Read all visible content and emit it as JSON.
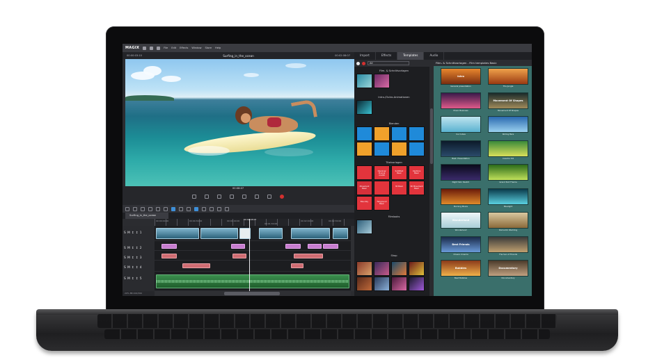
{
  "app": {
    "logo": "MAGIX",
    "menu": [
      "File",
      "Edit",
      "Effects",
      "Window",
      "Store",
      "Help"
    ]
  },
  "player": {
    "timecode_left": "00:00:03:10",
    "title": "Surfing_in_the_ocean",
    "timecode_right": "00:02:08:07",
    "timecode_center": "00:08:07"
  },
  "timeline": {
    "tab": "Surfing_in_the_ocean",
    "ruler_marks": [
      "00:00:00:00",
      "00:00:30:00",
      "00:01:00:00",
      "00:01:30:00",
      "00:02:00:00",
      "00:02:08:07",
      "00:02:30:00"
    ],
    "track_labels": [
      "S M ↕ ↕ 1",
      "S M ↕ ↕ 2",
      "S M ↕ ↕ 3",
      "S M ↕ ↕ 4",
      "S M ↕ ↕ 5"
    ],
    "status": "20%  8B 200/300"
  },
  "right_tabs": [
    "Import",
    "Effects",
    "Templates",
    "Audio"
  ],
  "right_active_tab": "Templates",
  "category_pane": {
    "filter_value": "All",
    "categories": [
      "Film- & Schnittvorlagen",
      "Intro-/Outro-Animationen",
      "Blenden",
      "Titelvorlagen",
      "Filmlooks",
      "Shop"
    ],
    "title_tiles": [
      "Opening/ Closing credits",
      "Subtitled Basic",
      "Captions Basic",
      "Movement Basic",
      "3D Basic",
      "3D Movement Basic",
      "Blue Sky",
      "Fairground Basic"
    ]
  },
  "templates_pane": {
    "header": "Film- & Schnittvorlagen - Film templates Basic",
    "items": [
      {
        "caption": "General presentation",
        "inner": "Intro"
      },
      {
        "caption": "The Jungle",
        "inner": ""
      },
      {
        "caption": "Music Business",
        "inner": ""
      },
      {
        "caption": "Movement Of Shapes",
        "inner": "Movement Of Shapes"
      },
      {
        "caption": "Ice Cubes",
        "inner": ""
      },
      {
        "caption": "Rolling Bars",
        "inner": ""
      },
      {
        "caption": "Best. Presentation",
        "inner": ""
      },
      {
        "caption": "Colorful Tilt",
        "inner": ""
      },
      {
        "caption": "Night Skin Sketch",
        "inner": ""
      },
      {
        "caption": "Grand Slot Theme",
        "inner": ""
      },
      {
        "caption": "Burning Movie",
        "inner": ""
      },
      {
        "caption": "Bluelight",
        "inner": ""
      },
      {
        "caption": "Wonderland",
        "inner": "Wonderland"
      },
      {
        "caption": "Romantic Wedding",
        "inner": ""
      },
      {
        "caption": "Cheers Cinema",
        "inner": "Best Friends"
      },
      {
        "caption": "The Sun of Friends",
        "inner": ""
      },
      {
        "caption": "Best Bubbles",
        "inner": "Bubbles"
      },
      {
        "caption": "Documentary",
        "inner": "Documentary"
      }
    ]
  },
  "colors": {
    "accent": "#3e8fd8",
    "record": "#d3302f",
    "template_bg": "#3a6f6b"
  }
}
